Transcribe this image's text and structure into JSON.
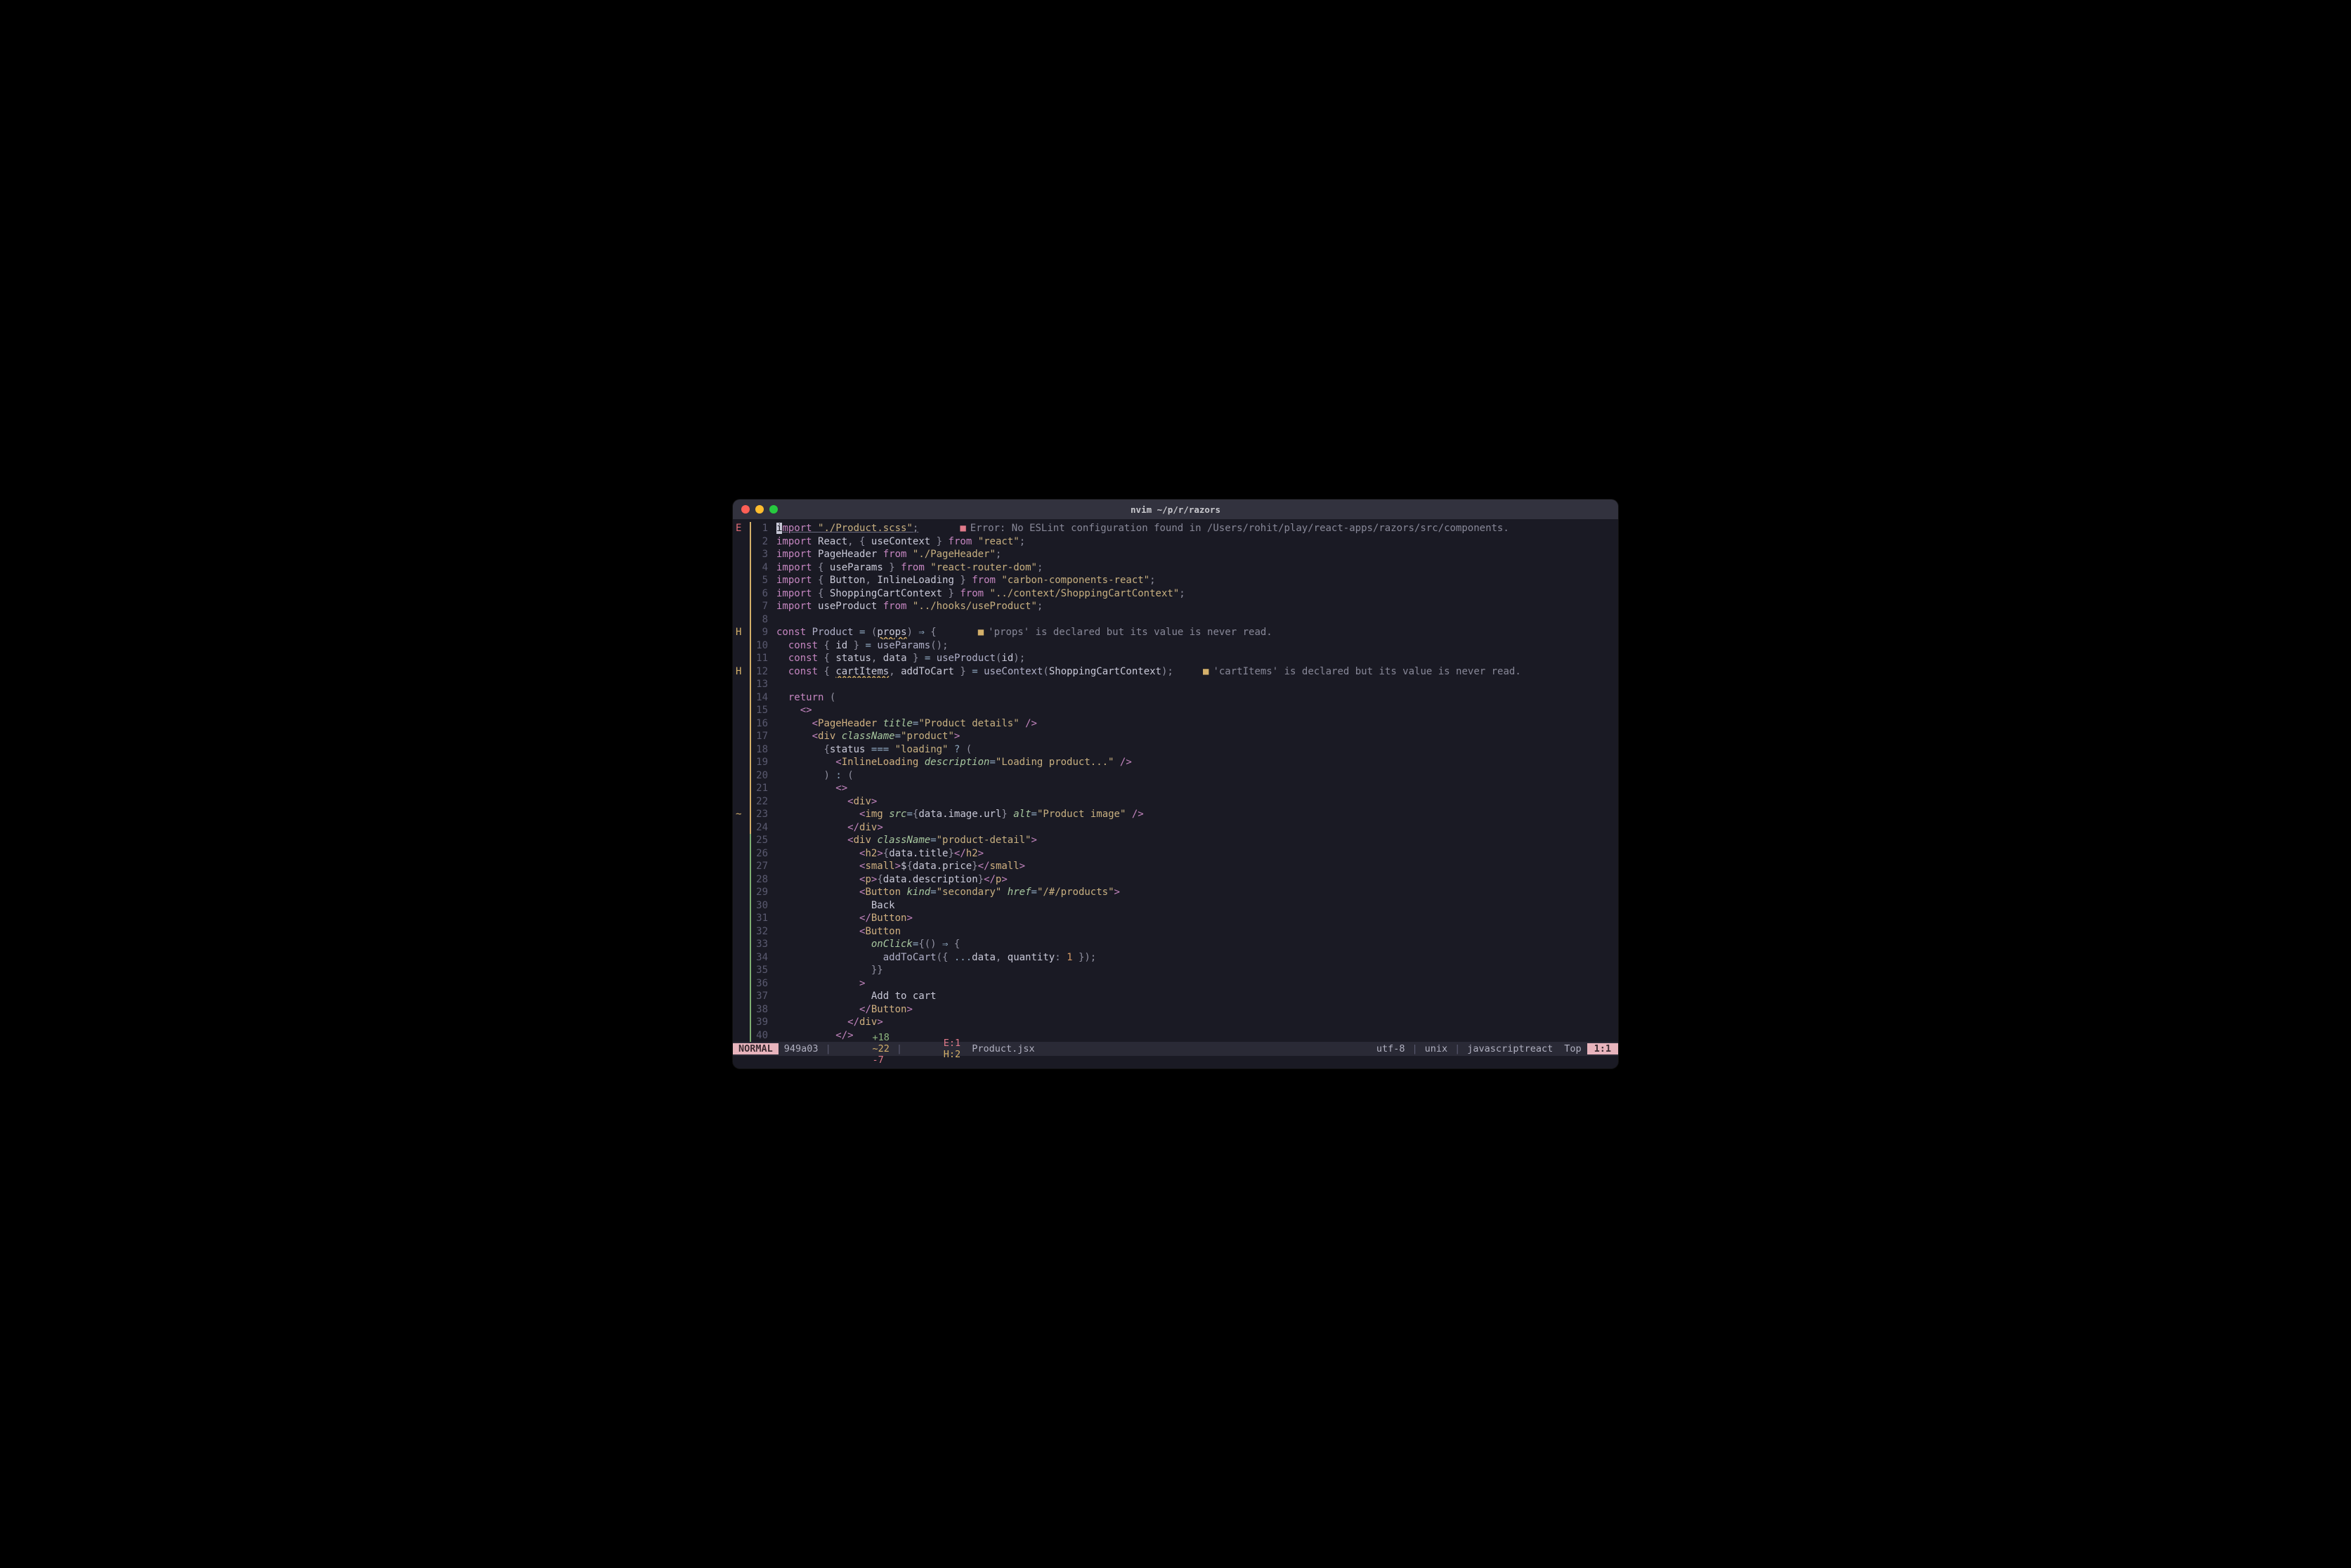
{
  "title": "nvim ~/p/r/razors",
  "lines": [
    {
      "n": 1,
      "sign": "E",
      "git": "mod",
      "html": "<span class='cursor-block'>i</span><span class='kw underline'>mport</span><span class='underline'> </span><span class='str underline'>\"./Product.scss\"</span><span class='punct underline'>;</span>       <span class='diag-icon'>■</span><span class='diag-msg'>Error: No ESLint configuration found in /Users/rohit/play/react-apps/razors/src/components.</span>"
    },
    {
      "n": 2,
      "git": "mod",
      "html": "<span class='kw'>import</span> <span class='ident'>React</span><span class='punct'>,</span> <span class='punct'>{</span> <span class='ident'>useContext</span> <span class='punct'>}</span> <span class='kw'>from</span> <span class='str'>\"react\"</span><span class='punct'>;</span>"
    },
    {
      "n": 3,
      "git": "mod",
      "html": "<span class='kw'>import</span> <span class='ident'>PageHeader</span> <span class='kw'>from</span> <span class='str'>\"./PageHeader\"</span><span class='punct'>;</span>"
    },
    {
      "n": 4,
      "git": "mod",
      "html": "<span class='kw'>import</span> <span class='punct'>{</span> <span class='ident'>useParams</span> <span class='punct'>}</span> <span class='kw'>from</span> <span class='str'>\"react-router-dom\"</span><span class='punct'>;</span>"
    },
    {
      "n": 5,
      "git": "mod",
      "html": "<span class='kw'>import</span> <span class='punct'>{</span> <span class='ident'>Button</span><span class='punct'>,</span> <span class='ident'>InlineLoading</span> <span class='punct'>}</span> <span class='kw'>from</span> <span class='str'>\"carbon-components-react\"</span><span class='punct'>;</span>"
    },
    {
      "n": 6,
      "git": "mod",
      "html": "<span class='kw'>import</span> <span class='punct'>{</span> <span class='ident'>ShoppingCartContext</span> <span class='punct'>}</span> <span class='kw'>from</span> <span class='str'>\"../context/ShoppingCartContext\"</span><span class='punct'>;</span>"
    },
    {
      "n": 7,
      "git": "mod",
      "html": "<span class='kw'>import</span> <span class='ident'>useProduct</span> <span class='kw'>from</span> <span class='str'>\"../hooks/useProduct\"</span><span class='punct'>;</span>"
    },
    {
      "n": 8,
      "git": "mod",
      "html": ""
    },
    {
      "n": 9,
      "sign": "H",
      "git": "mod",
      "html": "<span class='kw'>const</span> <span class='fn'>Product</span> <span class='op'>=</span> <span class='punct'>(</span><span class='ident squiggle underline'>props</span><span class='punct'>)</span> <span class='op'>⇒</span> <span class='punct'>{</span>       <span class='diag-icon hint'>■</span><span class='diag-msg'>'props' is declared but its value is never read.</span>"
    },
    {
      "n": 10,
      "git": "mod",
      "html": "  <span class='kw'>const</span> <span class='punct'>{</span> <span class='ident'>id</span> <span class='punct'>}</span> <span class='op'>=</span> <span class='fn'>useParams</span><span class='punct'>();</span>"
    },
    {
      "n": 11,
      "git": "mod",
      "html": "  <span class='kw'>const</span> <span class='punct'>{</span> <span class='ident'>status</span><span class='punct'>,</span> <span class='ident'>data</span> <span class='punct'>}</span> <span class='op'>=</span> <span class='fn'>useProduct</span><span class='punct'>(</span><span class='ident'>id</span><span class='punct'>);</span>"
    },
    {
      "n": 12,
      "sign": "H",
      "git": "mod",
      "html": "  <span class='kw'>const</span> <span class='punct'>{</span> <span class='ident squiggle underline'>cartItems</span><span class='punct'>,</span> <span class='ident'>addToCart</span> <span class='punct'>}</span> <span class='op'>=</span> <span class='fn'>useContext</span><span class='punct'>(</span><span class='ident'>ShoppingCartContext</span><span class='punct'>);</span>     <span class='diag-icon hint'>■</span><span class='diag-msg'>'cartItems' is declared but its value is never read.</span>"
    },
    {
      "n": 13,
      "git": "mod",
      "html": ""
    },
    {
      "n": 14,
      "git": "mod",
      "html": "  <span class='kw'>return</span> <span class='punct'>(</span>"
    },
    {
      "n": 15,
      "git": "mod",
      "html": "    <span class='tag'>&lt;&gt;</span>"
    },
    {
      "n": 16,
      "git": "mod",
      "html": "      <span class='tag'>&lt;</span><span class='tagname'>PageHeader</span> <span class='attr'>title</span><span class='op'>=</span><span class='str'>\"Product details\"</span> <span class='tag'>/&gt;</span>"
    },
    {
      "n": 17,
      "git": "mod",
      "html": "      <span class='tag'>&lt;</span><span class='tagname'>div</span> <span class='attr'>className</span><span class='op'>=</span><span class='str'>\"product\"</span><span class='tag'>&gt;</span>"
    },
    {
      "n": 18,
      "git": "mod",
      "html": "        <span class='punct'>{</span><span class='ident'>status</span> <span class='op'>===</span> <span class='str'>\"loading\"</span> <span class='op'>?</span> <span class='punct'>(</span>"
    },
    {
      "n": 19,
      "git": "mod",
      "html": "          <span class='tag'>&lt;</span><span class='tagname'>InlineLoading</span> <span class='attr'>description</span><span class='op'>=</span><span class='str'>\"Loading product...\"</span> <span class='tag'>/&gt;</span>"
    },
    {
      "n": 20,
      "git": "mod",
      "html": "        <span class='punct'>)</span> <span class='op'>:</span> <span class='punct'>(</span>"
    },
    {
      "n": 21,
      "git": "mod",
      "html": "          <span class='tag'>&lt;&gt;</span>"
    },
    {
      "n": 22,
      "git": "mod",
      "html": "            <span class='tag'>&lt;</span><span class='tagname'>div</span><span class='tag'>&gt;</span>"
    },
    {
      "n": 23,
      "sign": "~",
      "git": "mod",
      "html": "              <span class='tag'>&lt;</span><span class='tagname'>img</span> <span class='attr'>src</span><span class='op'>=</span><span class='punct'>{</span><span class='ident'>data.image.url</span><span class='punct'>}</span> <span class='attr'>alt</span><span class='op'>=</span><span class='str'>\"Product image\"</span> <span class='tag'>/&gt;</span>"
    },
    {
      "n": 24,
      "git": "mod",
      "html": "            <span class='tag'>&lt;/</span><span class='tagname'>div</span><span class='tag'>&gt;</span>"
    },
    {
      "n": 25,
      "git": "add",
      "html": "            <span class='tag'>&lt;</span><span class='tagname'>div</span> <span class='attr'>className</span><span class='op'>=</span><span class='str'>\"product-detail\"</span><span class='tag'>&gt;</span>"
    },
    {
      "n": 26,
      "git": "add",
      "html": "              <span class='tag'>&lt;</span><span class='tagname'>h2</span><span class='tag'>&gt;</span><span class='punct'>{</span><span class='ident'>data.title</span><span class='punct'>}</span><span class='tag'>&lt;/</span><span class='tagname'>h2</span><span class='tag'>&gt;</span>"
    },
    {
      "n": 27,
      "git": "add",
      "html": "              <span class='tag'>&lt;</span><span class='tagname'>small</span><span class='tag'>&gt;</span><span class='ident'>$</span><span class='punct'>{</span><span class='ident'>data.price</span><span class='punct'>}</span><span class='tag'>&lt;/</span><span class='tagname'>small</span><span class='tag'>&gt;</span>"
    },
    {
      "n": 28,
      "git": "add",
      "html": "              <span class='tag'>&lt;</span><span class='tagname'>p</span><span class='tag'>&gt;</span><span class='punct'>{</span><span class='ident'>data.description</span><span class='punct'>}</span><span class='tag'>&lt;/</span><span class='tagname'>p</span><span class='tag'>&gt;</span>"
    },
    {
      "n": 29,
      "git": "add",
      "html": "              <span class='tag'>&lt;</span><span class='tagname'>Button</span> <span class='attr'>kind</span><span class='op'>=</span><span class='str'>\"secondary\"</span> <span class='attr'>href</span><span class='op'>=</span><span class='str'>\"/#/products\"</span><span class='tag'>&gt;</span>"
    },
    {
      "n": 30,
      "git": "add",
      "html": "                <span class='ident'>Back</span>"
    },
    {
      "n": 31,
      "git": "add",
      "html": "              <span class='tag'>&lt;/</span><span class='tagname'>Button</span><span class='tag'>&gt;</span>"
    },
    {
      "n": 32,
      "git": "add",
      "html": "              <span class='tag'>&lt;</span><span class='tagname'>Button</span>"
    },
    {
      "n": 33,
      "git": "add",
      "html": "                <span class='attr'>onClick</span><span class='op'>=</span><span class='punct'>{()</span> <span class='op'>⇒</span> <span class='punct'>{</span>"
    },
    {
      "n": 34,
      "git": "add",
      "html": "                  <span class='fn'>addToCart</span><span class='punct'>({</span> <span class='op'>...</span><span class='ident'>data</span><span class='punct'>,</span> <span class='ident'>quantity</span><span class='punct'>:</span> <span class='num'>1</span> <span class='punct'>});</span>"
    },
    {
      "n": 35,
      "git": "add",
      "html": "                <span class='punct'>}}</span>"
    },
    {
      "n": 36,
      "git": "add",
      "html": "              <span class='tag'>&gt;</span>"
    },
    {
      "n": 37,
      "git": "add",
      "html": "                <span class='ident'>Add to cart</span>"
    },
    {
      "n": 38,
      "git": "add",
      "html": "              <span class='tag'>&lt;/</span><span class='tagname'>Button</span><span class='tag'>&gt;</span>"
    },
    {
      "n": 39,
      "git": "add",
      "html": "            <span class='tag'>&lt;/</span><span class='tagname'>div</span><span class='tag'>&gt;</span>"
    },
    {
      "n": 40,
      "git": "add",
      "html": "          <span class='tag'>&lt;/&gt;</span>"
    }
  ],
  "status": {
    "mode": "NORMAL",
    "git_hash": "949a03",
    "diff_add": "+18",
    "diff_mod": "~22",
    "diff_del": "-7",
    "diag_err": "E:1",
    "diag_hint": "H:2",
    "filename": "Product.jsx",
    "encoding": "utf-8",
    "fileformat": "unix",
    "filetype": "javascriptreact",
    "scroll": "Top",
    "pos": "1:1"
  }
}
